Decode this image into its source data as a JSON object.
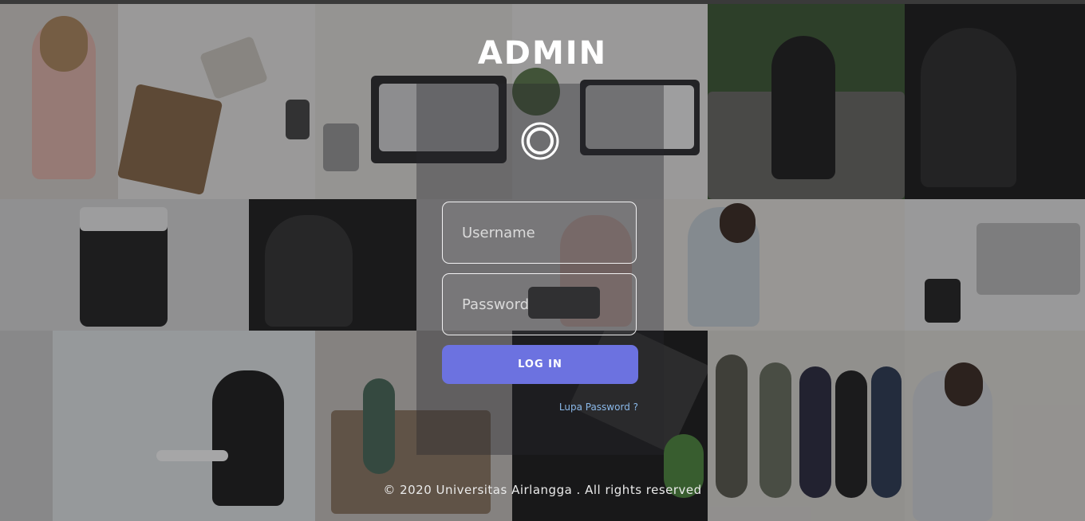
{
  "header": {
    "title": "ADMIN"
  },
  "login": {
    "username_placeholder": "Username",
    "password_placeholder": "Password",
    "login_label": "LOG IN",
    "forgot_label": "Lupa Password ?"
  },
  "footer": {
    "copyright": "© 2020 Universitas Airlangga . All rights reserved"
  },
  "theme": {
    "accent": "#6c72e0",
    "link": "#8ab8e8"
  },
  "icons": {
    "logo": "circle-logo-icon"
  }
}
